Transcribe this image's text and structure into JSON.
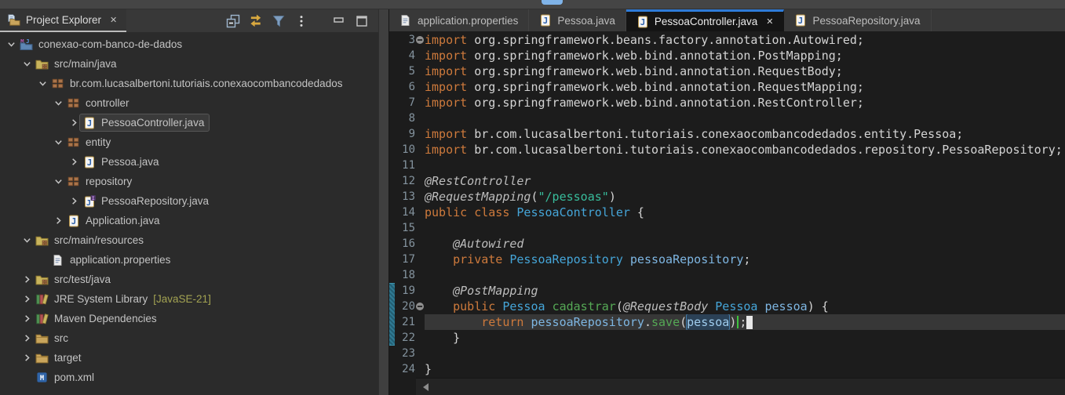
{
  "window": {
    "top_chip_color": "#7FB3E8",
    "accent_blue": "#2E7BD8"
  },
  "explorer": {
    "tab_label": "Project Explorer",
    "close_glyph": "✕",
    "toolbar": [
      {
        "name": "collapse-all"
      },
      {
        "name": "link-with-editor"
      },
      {
        "name": "filter"
      },
      {
        "name": "view-menu"
      },
      {
        "name": "minimize"
      },
      {
        "name": "maximize"
      }
    ],
    "tree": [
      {
        "label": "conexao-com-banco-de-dados",
        "level": 0,
        "chevron": "expanded",
        "icon": "maven-project"
      },
      {
        "label": "src/main/java",
        "level": 1,
        "chevron": "expanded",
        "icon": "source-folder"
      },
      {
        "label": "br.com.lucasalbertoni.tutoriais.conexaocombancodedados",
        "level": 2,
        "chevron": "expanded",
        "icon": "package"
      },
      {
        "label": "controller",
        "level": 3,
        "chevron": "expanded",
        "icon": "package"
      },
      {
        "label": "PessoaController.java",
        "level": 4,
        "chevron": "collapsed",
        "icon": "java-file",
        "selected": true
      },
      {
        "label": "entity",
        "level": 3,
        "chevron": "expanded",
        "icon": "package"
      },
      {
        "label": "Pessoa.java",
        "level": 4,
        "chevron": "collapsed",
        "icon": "java-file"
      },
      {
        "label": "repository",
        "level": 3,
        "chevron": "expanded",
        "icon": "package"
      },
      {
        "label": "PessoaRepository.java",
        "level": 4,
        "chevron": "collapsed",
        "icon": "java-interface-file"
      },
      {
        "label": "Application.java",
        "level": 3,
        "chevron": "collapsed",
        "icon": "java-file"
      },
      {
        "label": "src/main/resources",
        "level": 1,
        "chevron": "expanded",
        "icon": "source-folder"
      },
      {
        "label": "application.properties",
        "level": 2,
        "chevron": "none",
        "icon": "file"
      },
      {
        "label": "src/test/java",
        "level": 1,
        "chevron": "collapsed",
        "icon": "source-folder"
      },
      {
        "label": "JRE System Library",
        "suffix": " [JavaSE-21]",
        "suffix_color": "#A3A352",
        "level": 1,
        "chevron": "collapsed",
        "icon": "library"
      },
      {
        "label": "Maven Dependencies",
        "level": 1,
        "chevron": "collapsed",
        "icon": "library"
      },
      {
        "label": "src",
        "level": 1,
        "chevron": "collapsed",
        "icon": "folder"
      },
      {
        "label": "target",
        "level": 1,
        "chevron": "collapsed",
        "icon": "folder"
      },
      {
        "label": "pom.xml",
        "level": 1,
        "chevron": "none",
        "icon": "maven-file"
      }
    ]
  },
  "editor": {
    "tabs": [
      {
        "label": "application.properties",
        "icon": "file",
        "active": false
      },
      {
        "label": "Pessoa.java",
        "icon": "java-file",
        "active": false
      },
      {
        "label": "PessoaController.java",
        "icon": "java-file",
        "active": true,
        "close_glyph": "✕"
      },
      {
        "label": "PessoaRepository.java",
        "icon": "java-file",
        "active": false
      }
    ],
    "code": {
      "current_line": 21,
      "change_bar_lines": [
        19,
        22
      ],
      "line_number_color": "#84939E",
      "token_colors": {
        "kw": "#CE7A3C",
        "def": "#D4D4D4",
        "ann": "#BDBDBD",
        "typ": "#45A5D8",
        "var": "#7EB6E2",
        "met": "#55A855",
        "str": "#38BD9C",
        "occ": "#9FCDEE"
      },
      "lines": [
        {
          "num": 3,
          "fold": true,
          "tokens": [
            [
              "kw",
              "import"
            ],
            [
              "def",
              " org.springframework.beans.factory.annotation.Autowired;"
            ]
          ]
        },
        {
          "num": 4,
          "tokens": [
            [
              "kw",
              "import"
            ],
            [
              "def",
              " org.springframework.web.bind.annotation.PostMapping;"
            ]
          ]
        },
        {
          "num": 5,
          "tokens": [
            [
              "kw",
              "import"
            ],
            [
              "def",
              " org.springframework.web.bind.annotation.RequestBody;"
            ]
          ]
        },
        {
          "num": 6,
          "tokens": [
            [
              "kw",
              "import"
            ],
            [
              "def",
              " org.springframework.web.bind.annotation.RequestMapping;"
            ]
          ]
        },
        {
          "num": 7,
          "tokens": [
            [
              "kw",
              "import"
            ],
            [
              "def",
              " org.springframework.web.bind.annotation.RestController;"
            ]
          ]
        },
        {
          "num": 8,
          "tokens": []
        },
        {
          "num": 9,
          "tokens": [
            [
              "kw",
              "import"
            ],
            [
              "def",
              " br.com.lucasalbertoni.tutoriais.conexaocombancodedados.entity.Pessoa;"
            ]
          ]
        },
        {
          "num": 10,
          "tokens": [
            [
              "kw",
              "import"
            ],
            [
              "def",
              " br.com.lucasalbertoni.tutoriais.conexaocombancodedados.repository.PessoaRepository;"
            ]
          ]
        },
        {
          "num": 11,
          "tokens": []
        },
        {
          "num": 12,
          "tokens": [
            [
              "ann",
              "@RestController"
            ]
          ]
        },
        {
          "num": 13,
          "tokens": [
            [
              "ann",
              "@RequestMapping"
            ],
            [
              "def",
              "("
            ],
            [
              "str",
              "\"/pessoas\""
            ],
            [
              "def",
              ")"
            ]
          ]
        },
        {
          "num": 14,
          "tokens": [
            [
              "kw",
              "public"
            ],
            [
              "def",
              " "
            ],
            [
              "kw",
              "class"
            ],
            [
              "def",
              " "
            ],
            [
              "typ",
              "PessoaController"
            ],
            [
              "def",
              " {"
            ]
          ]
        },
        {
          "num": 15,
          "tokens": []
        },
        {
          "num": 16,
          "tokens": [
            [
              "def",
              "    "
            ],
            [
              "ann",
              "@Autowired"
            ]
          ]
        },
        {
          "num": 17,
          "tokens": [
            [
              "def",
              "    "
            ],
            [
              "kw",
              "private"
            ],
            [
              "def",
              " "
            ],
            [
              "typ",
              "PessoaRepository"
            ],
            [
              "def",
              " "
            ],
            [
              "var",
              "pessoaRepository"
            ],
            [
              "def",
              ";"
            ]
          ]
        },
        {
          "num": 18,
          "tokens": []
        },
        {
          "num": 19,
          "tokens": [
            [
              "def",
              "    "
            ],
            [
              "ann",
              "@PostMapping"
            ]
          ]
        },
        {
          "num": 20,
          "fold": true,
          "tokens": [
            [
              "def",
              "    "
            ],
            [
              "kw",
              "public"
            ],
            [
              "def",
              " "
            ],
            [
              "typ",
              "Pessoa"
            ],
            [
              "def",
              " "
            ],
            [
              "met",
              "cadastrar"
            ],
            [
              "def",
              "("
            ],
            [
              "ann",
              "@RequestBody"
            ],
            [
              "def",
              " "
            ],
            [
              "typ",
              "Pessoa"
            ],
            [
              "def",
              " "
            ],
            [
              "var",
              "pessoa"
            ],
            [
              "def",
              ") {"
            ]
          ]
        },
        {
          "num": 21,
          "tokens": [
            [
              "def",
              "        "
            ],
            [
              "kw",
              "return"
            ],
            [
              "def",
              " "
            ],
            [
              "var",
              "pessoaRepository"
            ],
            [
              "def",
              "."
            ],
            [
              "met",
              "save"
            ],
            [
              "def",
              "("
            ],
            [
              "occ",
              "pessoa"
            ],
            [
              "def",
              ")"
            ],
            [
              "mark",
              ""
            ],
            [
              "def",
              ";"
            ],
            [
              "cursor",
              ""
            ]
          ]
        },
        {
          "num": 22,
          "tokens": [
            [
              "def",
              "    }"
            ]
          ]
        },
        {
          "num": 23,
          "tokens": []
        },
        {
          "num": 24,
          "tokens": [
            [
              "def",
              "}"
            ]
          ]
        }
      ]
    }
  }
}
